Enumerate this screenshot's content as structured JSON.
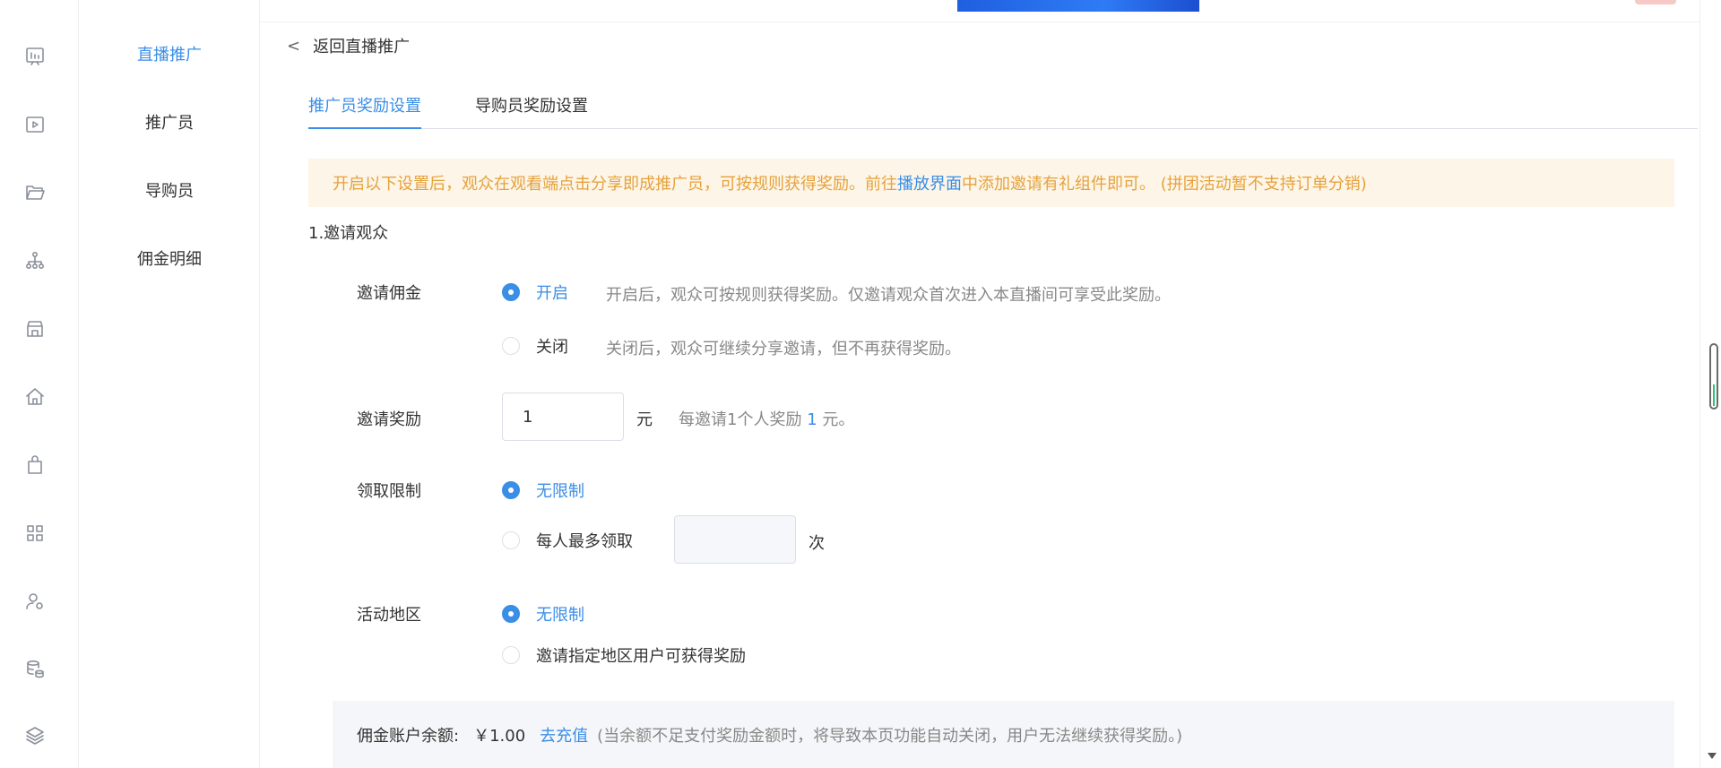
{
  "rail": {
    "icons": [
      "chart-board-icon",
      "video-play-icon",
      "folder-icon",
      "org-tree-icon",
      "store-icon",
      "home-icon",
      "shopping-bag-icon",
      "apps-grid-icon",
      "user-settings-icon",
      "database-coins-icon",
      "layers-icon"
    ]
  },
  "submenu": {
    "items": [
      "直播推广",
      "推广员",
      "导购员",
      "佣金明细"
    ],
    "active": "直播推广"
  },
  "header": {
    "back_label": "返回直播推广"
  },
  "tabs": {
    "items": [
      "推广员奖励设置",
      "导购员奖励设置"
    ],
    "active": "推广员奖励设置"
  },
  "notice": {
    "text_before": "开启以下设置后，观众在观看端点击分享即成推广员，可按规则获得奖励。前往",
    "link": "播放界面",
    "text_after": "中添加邀请有礼组件即可。 (拼团活动暂不支持订单分销)"
  },
  "section": {
    "title": "1.邀请观众"
  },
  "invite_commission": {
    "label": "邀请佣金",
    "on_label": "开启",
    "on_hint": "开启后，观众可按规则获得奖励。仅邀请观众首次进入本直播间可享受此奖励。",
    "off_label": "关闭",
    "off_hint": "关闭后，观众可继续分享邀请，但不再获得奖励。",
    "selected": "on"
  },
  "invite_reward": {
    "label": "邀请奖励",
    "value": "1",
    "unit": "元",
    "desc_before": "每邀请1个人奖励",
    "desc_num": "1",
    "desc_after": "元。"
  },
  "claim_limit": {
    "label": "领取限制",
    "unlimited_label": "无限制",
    "max_label": "每人最多领取",
    "max_value": "",
    "unit": "次",
    "selected": "unlimited"
  },
  "region": {
    "label": "活动地区",
    "unlimited_label": "无限制",
    "specific_label": "邀请指定地区用户可获得奖励",
    "selected": "unlimited"
  },
  "balance": {
    "label": "佣金账户余额:",
    "amount": "￥1.00",
    "recharge_link": "去充值",
    "note": "(当余额不足支付奖励金额时，将导致本页功能自动关闭，用户无法继续获得奖励。)"
  },
  "colors": {
    "accent": "#3a8ee6",
    "warning_text": "#e6a23c",
    "warning_bg": "#fdf5e7"
  }
}
